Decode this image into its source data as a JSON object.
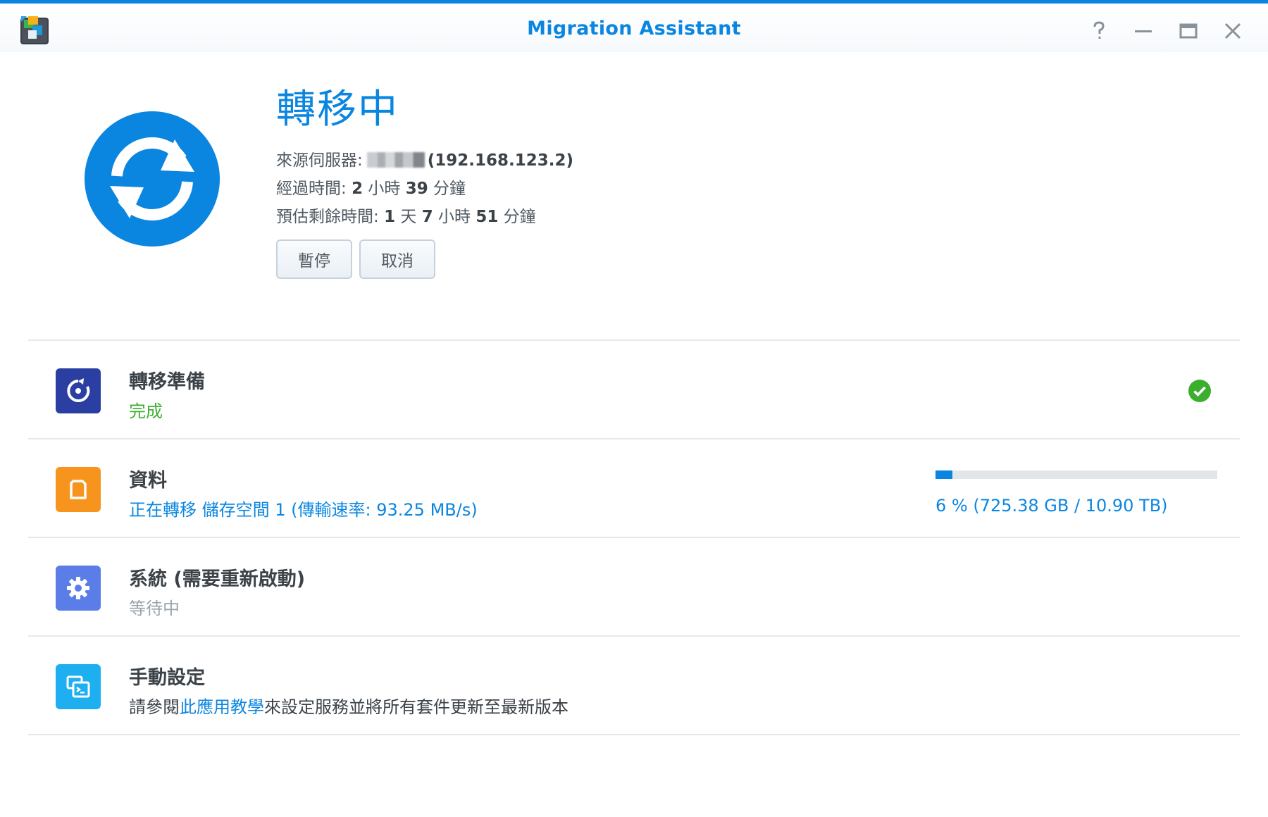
{
  "window": {
    "title": "Migration Assistant",
    "accent_color": "#0b86e0",
    "controls": [
      "help-icon",
      "minimize-icon",
      "maximize-icon",
      "close-icon"
    ]
  },
  "header": {
    "status_title": "轉移中",
    "source": {
      "label": "來源伺服器:",
      "ip": "(192.168.123.2)"
    },
    "elapsed": {
      "label": "經過時間:",
      "n1": "2",
      "u1": "小時",
      "n2": "39",
      "u2": "分鐘"
    },
    "remaining": {
      "label": "預估剩餘時間:",
      "n1": "1",
      "u1": "天",
      "n2": "7",
      "u2": "小時",
      "n3": "51",
      "u3": "分鐘"
    },
    "buttons": {
      "pause": "暫停",
      "cancel": "取消"
    }
  },
  "tasks": [
    {
      "title": "轉移準備",
      "status": "完成",
      "status_color": "#3cae2f",
      "icon": "refresh-step-icon",
      "icon_color": "#2b3fa3",
      "state_icon": "check-circle-icon"
    },
    {
      "title": "資料",
      "status": "正在轉移 儲存空間 1 (傳輸速率: 93.25 MB/s)",
      "status_color": "#0b86e0",
      "icon": "document-icon",
      "icon_color": "#f7941d",
      "progress": {
        "percent": 6,
        "text": "6 % (725.38 GB / 10.90 TB)"
      }
    },
    {
      "title": "系統 (需要重新啟動)",
      "status": "等待中",
      "status_color": "#9aa3ab",
      "icon": "gear-icon",
      "icon_color": "#5a7de8"
    },
    {
      "title": "手動設定",
      "status_prefix": "請參閱",
      "status_link": "此應用教學",
      "status_suffix": "來設定服務並將所有套件更新至最新版本",
      "icon": "terminal-windows-icon",
      "icon_color": "#1eaff0"
    }
  ]
}
